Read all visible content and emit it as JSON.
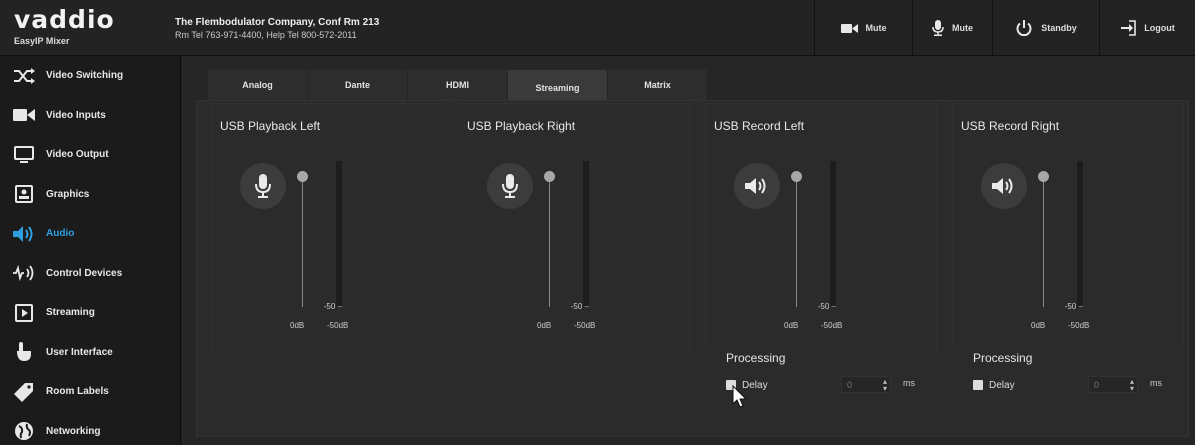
{
  "app": {
    "logo_text": "vaddio",
    "logo_subtitle": "EasyIP Mixer",
    "company_line1": "The Flembodulator Company, Conf Rm 213",
    "company_line2": "Rm Tel 763-971-4400, Help Tel 800-572-2011"
  },
  "header_actions": [
    {
      "label": "Mute",
      "icon": "video-camera-icon"
    },
    {
      "label": "Mute",
      "icon": "microphone-icon"
    },
    {
      "label": "Standby",
      "icon": "power-icon"
    },
    {
      "label": "Logout",
      "icon": "logout-icon"
    }
  ],
  "sidebar": {
    "items": [
      {
        "label": "Video Switching",
        "icon": "shuffle-icon",
        "active": false
      },
      {
        "label": "Video Inputs",
        "icon": "video-camera-icon",
        "active": false
      },
      {
        "label": "Video Output",
        "icon": "monitor-icon",
        "active": false
      },
      {
        "label": "Graphics",
        "icon": "graphics-icon",
        "active": false
      },
      {
        "label": "Audio",
        "icon": "speaker-icon",
        "active": true
      },
      {
        "label": "Control Devices",
        "icon": "control-devices-icon",
        "active": false
      },
      {
        "label": "Streaming",
        "icon": "play-icon",
        "active": false
      },
      {
        "label": "User Interface",
        "icon": "user-interface-icon",
        "active": false
      },
      {
        "label": "Room Labels",
        "icon": "tag-icon",
        "active": false
      },
      {
        "label": "Networking",
        "icon": "globe-icon",
        "active": false
      }
    ]
  },
  "tabs": [
    {
      "label": "Analog",
      "active": false
    },
    {
      "label": "Dante",
      "active": false
    },
    {
      "label": "HDMI",
      "active": false
    },
    {
      "label": "Streaming",
      "active": true
    },
    {
      "label": "Matrix",
      "active": false
    }
  ],
  "channels": [
    {
      "title": "USB Playback Left",
      "icon": "microphone-icon",
      "meter_tick": "-50 –",
      "label_min": "0dB",
      "label_max": "-50dB"
    },
    {
      "title": "USB Playback Right",
      "icon": "microphone-icon",
      "meter_tick": "-50 –",
      "label_min": "0dB",
      "label_max": "-50dB"
    },
    {
      "title": "USB Record Left",
      "icon": "speaker-icon",
      "meter_tick": "-50 –",
      "label_min": "0dB",
      "label_max": "-50dB"
    },
    {
      "title": "USB Record Right",
      "icon": "speaker-icon",
      "meter_tick": "-50 –",
      "label_min": "0dB",
      "label_max": "-50dB"
    }
  ],
  "processing": [
    {
      "title": "Processing",
      "delay_label": "Delay",
      "delay_value": "0",
      "delay_unit": "ms",
      "checked": true
    },
    {
      "title": "Processing",
      "delay_label": "Delay",
      "delay_value": "0",
      "delay_unit": "ms",
      "checked": true
    }
  ],
  "colors": {
    "accent": "#2f9fe0",
    "background": "#1f1f1f",
    "panel": "#2b2b2b"
  }
}
